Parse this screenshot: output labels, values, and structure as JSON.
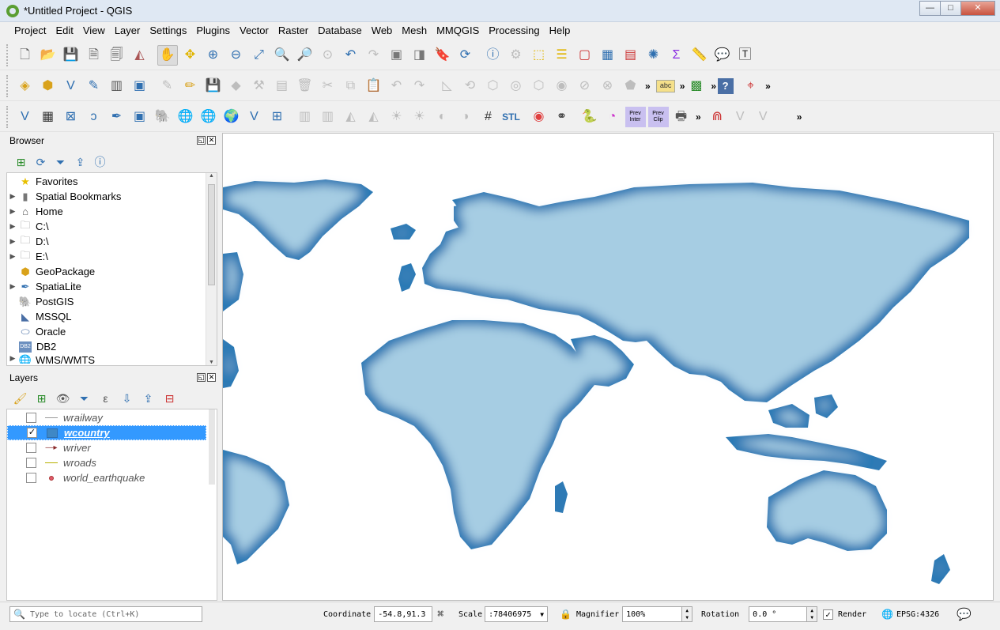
{
  "window": {
    "title": "*Untitled Project - QGIS",
    "minimize": "—",
    "maximize": "□",
    "close": "✕"
  },
  "menu": [
    "Project",
    "Edit",
    "View",
    "Layer",
    "Settings",
    "Plugins",
    "Vector",
    "Raster",
    "Database",
    "Web",
    "Mesh",
    "MMQGIS",
    "Processing",
    "Help"
  ],
  "toolbar_icons": {
    "row1": [
      "new-project-icon",
      "open-project-icon",
      "save-project-icon",
      "new-print-layout-icon",
      "layout-manager-icon",
      "style-manager-icon",
      "pan-map-icon",
      "pan-to-selection-icon",
      "zoom-in-icon",
      "zoom-out-icon",
      "zoom-full-icon",
      "zoom-to-selection-icon",
      "zoom-to-layer-icon",
      "zoom-native-icon",
      "zoom-last-icon",
      "zoom-next-icon",
      "new-map-view-icon",
      "new-3d-view-icon",
      "show-bookmarks-icon",
      "refresh-icon",
      "identify-icon",
      "action-icon",
      "select-features-icon",
      "select-by-value-icon",
      "deselect-icon",
      "attribute-table-icon",
      "field-calculator-icon",
      "toolbox-icon",
      "statistics-icon",
      "measure-icon",
      "map-tips-icon",
      "text-annotation-icon"
    ],
    "row2": [
      "data-source-manager-icon",
      "new-geopackage-icon",
      "new-shapefile-icon",
      "new-temp-layer-icon",
      "new-virtual-layer-icon",
      "digitize-icon",
      "toggle-edit-icon",
      "pencil-icon",
      "save-edits-icon",
      "add-feature-icon",
      "vertex-tool-icon",
      "modify-attributes-icon",
      "delete-selected-icon",
      "cut-icon",
      "copy-icon",
      "paste-icon",
      "undo-icon",
      "redo-icon",
      "advanced-digitize-icon",
      "rotate-icon",
      "simplify-icon",
      "add-ring-icon",
      "add-part-icon",
      "fill-ring-icon",
      "delete-ring-icon",
      "delete-part-icon",
      "reshape-icon",
      "label-icon",
      "plugin-icon",
      "help-icon",
      "crosshair-icon"
    ],
    "row3": [
      "add-vector-icon",
      "add-raster-icon",
      "add-mesh-icon",
      "add-delimited-text-icon",
      "add-spatialite-icon",
      "add-virtual-icon",
      "add-postgis-icon",
      "add-wms-icon",
      "add-wfs-icon",
      "add-arcgis-icon",
      "add-vector-tile-icon",
      "add-wcs-icon",
      "gps-icon",
      "georef-icon",
      "dem-icon",
      "profile-icon",
      "shade-icon",
      "sun-icon",
      "light-icon",
      "terrain-icon",
      "view-icon",
      "grid-icon",
      "stl-icon",
      "record-icon",
      "binoculars-icon",
      "python-icon",
      "clip-icon",
      "prev-inter-icon",
      "prev-clip-icon",
      "print-icon",
      "magnet-icon",
      "snap-icon"
    ]
  },
  "toolbar_labels": {
    "stl": "STL",
    "prev_inter": "Prev\nInter",
    "prev_clip": "Prev\nClip",
    "abc": "abc",
    "help": "?",
    "more": "»"
  },
  "browser": {
    "title": "Browser",
    "items": [
      {
        "label": "Favorites",
        "icon": "star-icon",
        "expandable": false
      },
      {
        "label": "Spatial Bookmarks",
        "icon": "bookmark-icon",
        "expandable": true
      },
      {
        "label": "Home",
        "icon": "home-icon",
        "expandable": true
      },
      {
        "label": "C:\\",
        "icon": "folder-icon",
        "expandable": true
      },
      {
        "label": "D:\\",
        "icon": "folder-icon",
        "expandable": true
      },
      {
        "label": "E:\\",
        "icon": "folder-icon",
        "expandable": true
      },
      {
        "label": "GeoPackage",
        "icon": "geopackage-icon",
        "expandable": false
      },
      {
        "label": "SpatiaLite",
        "icon": "spatialite-icon",
        "expandable": true
      },
      {
        "label": "PostGIS",
        "icon": "postgis-icon",
        "expandable": false
      },
      {
        "label": "MSSQL",
        "icon": "mssql-icon",
        "expandable": false
      },
      {
        "label": "Oracle",
        "icon": "oracle-icon",
        "expandable": false
      },
      {
        "label": "DB2",
        "icon": "db2-icon",
        "expandable": false
      },
      {
        "label": "WMS/WMTS",
        "icon": "wms-icon",
        "expandable": true
      }
    ],
    "db2_text": "DB2"
  },
  "layers": {
    "title": "Layers",
    "items": [
      {
        "label": "wrailway",
        "checked": false,
        "selected": false,
        "symbol": "line"
      },
      {
        "label": "wcountry",
        "checked": true,
        "selected": true,
        "symbol": "fill"
      },
      {
        "label": "wriver",
        "checked": false,
        "selected": false,
        "symbol": "arrow-line"
      },
      {
        "label": "wroads",
        "checked": false,
        "selected": false,
        "symbol": "yellow-line"
      },
      {
        "label": "world_earthquake",
        "checked": false,
        "selected": false,
        "symbol": "point"
      }
    ],
    "check_mark": "✓"
  },
  "map": {
    "ocean_color": "#ffffff",
    "land_fill": "#a6cde3",
    "land_edge": "#2f7ab5"
  },
  "status": {
    "locate_placeholder": "Type to locate (Ctrl+K)",
    "coordinate_label": "Coordinate",
    "coordinate_value": "-54.8,91.3",
    "scale_label": "Scale",
    "scale_value": ":78406975",
    "magnifier_label": "Magnifier",
    "magnifier_value": "100%",
    "rotation_label": "Rotation",
    "rotation_value": "0.0 °",
    "render_label": "Render",
    "render_checked": "✓",
    "crs": "EPSG:4326"
  }
}
